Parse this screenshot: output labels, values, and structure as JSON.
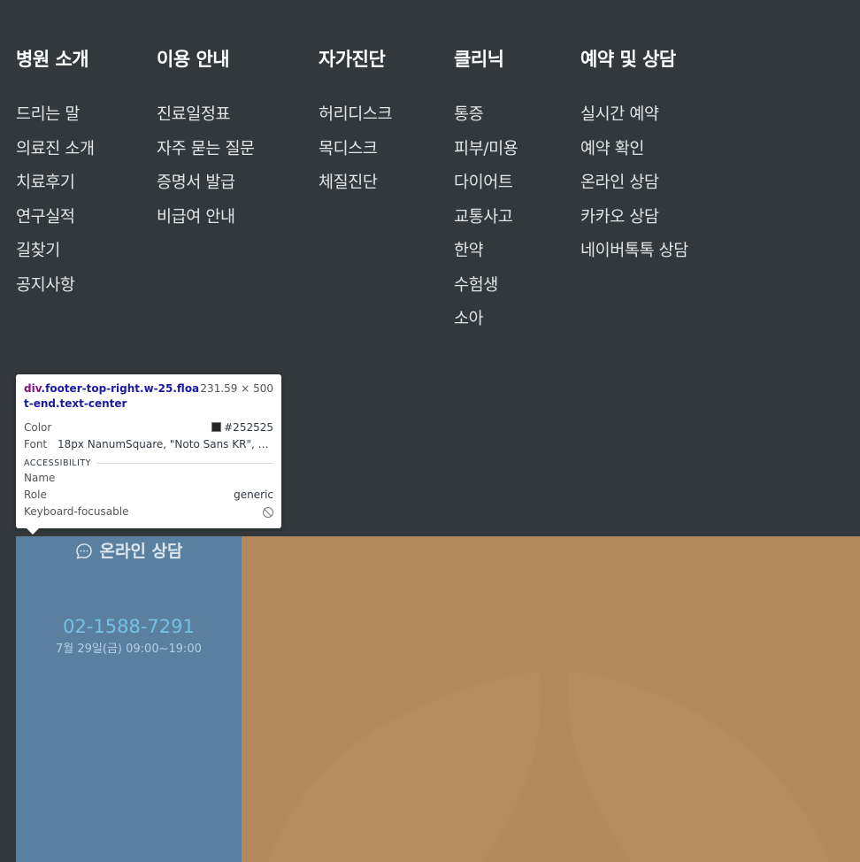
{
  "footer_nav": [
    {
      "title": "병원 소개",
      "items": [
        "드리는 말",
        "의료진 소개",
        "치료후기",
        "연구실적",
        "길찾기",
        "공지사항"
      ]
    },
    {
      "title": "이용 안내",
      "items": [
        "진료일정표",
        "자주 묻는 질문",
        "증명서 발급",
        "비급여 안내"
      ]
    },
    {
      "title": "자가진단",
      "items": [
        "허리디스크",
        "목디스크",
        "체질진단"
      ]
    },
    {
      "title": "클리닉",
      "items": [
        "통증",
        "피부/미용",
        "다이어트",
        "교통사고",
        "한약",
        "수험생",
        "소아"
      ]
    },
    {
      "title": "예약 및 상담",
      "items": [
        "실시간 예약",
        "예약 확인",
        "온라인 상담",
        "카카오 상담",
        "네이버톡톡 상담"
      ]
    }
  ],
  "devtools_tooltip": {
    "tag": "div",
    "selector": ".footer-top-right.w-25.float-end.text-center",
    "size": "231.59 × 500",
    "color_label": "Color",
    "color_value": "#252525",
    "font_label": "Font",
    "font_value": "18px NanumSquare, \"Noto Sans KR\", \"M...",
    "section_title": "ACCESSIBILITY",
    "name_label": "Name",
    "name_value": "",
    "role_label": "Role",
    "role_value": "generic",
    "focusable_label": "Keyboard-focusable",
    "focusable_icon": "not-allowed-icon"
  },
  "consult": {
    "icon": "chat-bubble-icon",
    "title": "온라인 상담",
    "phone": "02-1588-7291",
    "hours": "7월 29일(금) 09:00~19:00"
  },
  "colors": {
    "background": "#32383b",
    "consult_box": "#5b809f",
    "banner": "#b3895b",
    "phone": "#75c0e6"
  }
}
